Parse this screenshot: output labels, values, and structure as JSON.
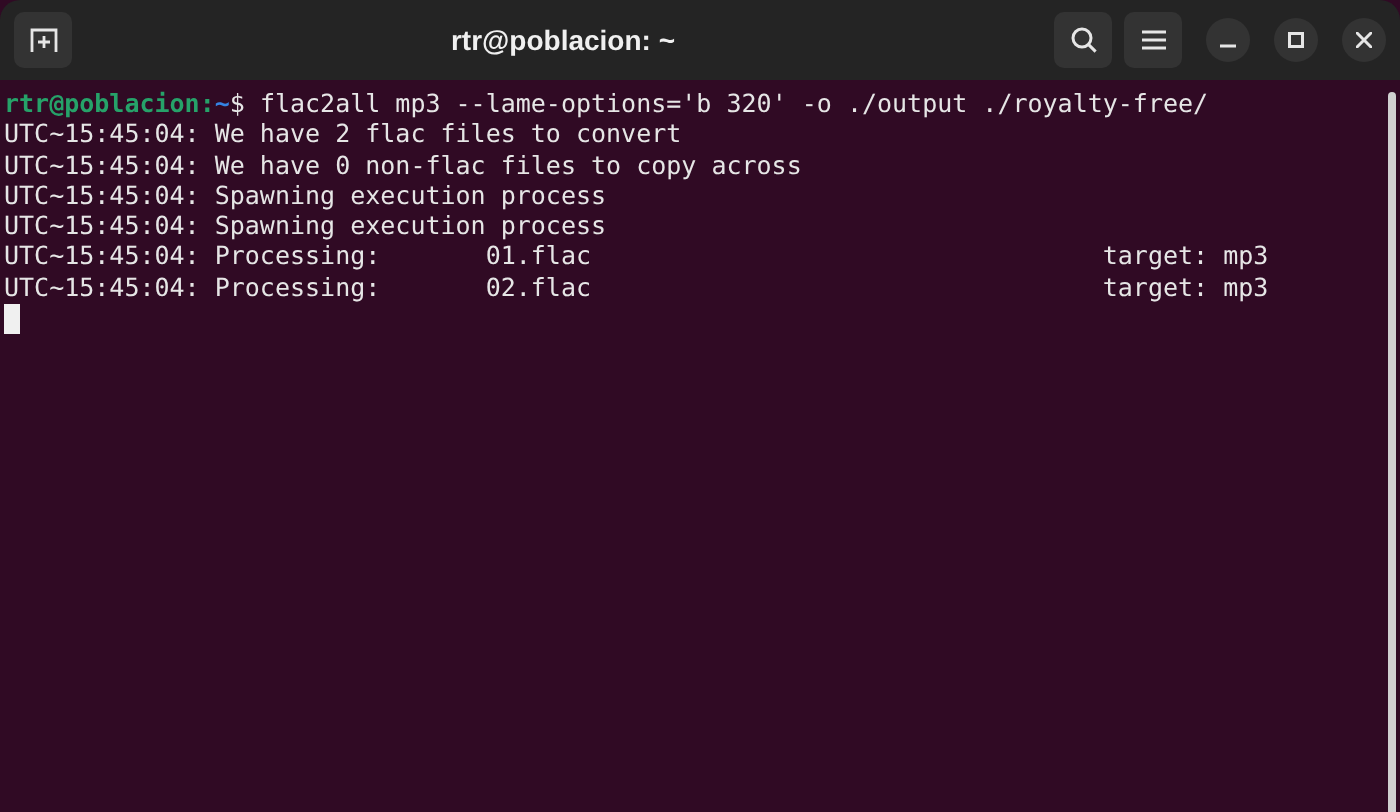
{
  "window": {
    "title": "rtr@poblacion: ~"
  },
  "prompt": {
    "user_host": "rtr@poblacion",
    "separator": ":",
    "path": "~",
    "symbol": "$",
    "command": "flac2all mp3 --lame-options='b 320' -o ./output ./royalty-free/"
  },
  "output": [
    "UTC~15:45:04: We have 2 flac files to convert",
    "UTC~15:45:04: We have 0 non-flac files to copy across",
    "UTC~15:45:04: Spawning execution process",
    "UTC~15:45:04: Spawning execution process",
    "UTC~15:45:04: Processing:       01.flac                                  target: mp3",
    "UTC~15:45:04: Processing:       02.flac                                  target: mp3"
  ]
}
